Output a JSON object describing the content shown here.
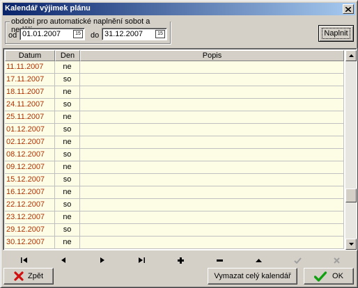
{
  "window": {
    "title": "Kalendář výjimek plánu"
  },
  "period": {
    "legend": "období pro automatické naplnění sobot a nedělí",
    "from_label": "od",
    "from_value": "01.01.2007",
    "to_label": "do",
    "to_value": "31.12.2007",
    "cal_icon_text": "15",
    "fill_button": "Naplnit"
  },
  "grid": {
    "columns": [
      "Datum",
      "Den",
      "Popis"
    ],
    "rows": [
      [
        "11.11.2007",
        "ne",
        ""
      ],
      [
        "17.11.2007",
        "so",
        ""
      ],
      [
        "18.11.2007",
        "ne",
        ""
      ],
      [
        "24.11.2007",
        "so",
        ""
      ],
      [
        "25.11.2007",
        "ne",
        ""
      ],
      [
        "01.12.2007",
        "so",
        ""
      ],
      [
        "02.12.2007",
        "ne",
        ""
      ],
      [
        "08.12.2007",
        "so",
        ""
      ],
      [
        "09.12.2007",
        "ne",
        ""
      ],
      [
        "15.12.2007",
        "so",
        ""
      ],
      [
        "16.12.2007",
        "ne",
        ""
      ],
      [
        "22.12.2007",
        "so",
        ""
      ],
      [
        "23.12.2007",
        "ne",
        ""
      ],
      [
        "29.12.2007",
        "so",
        ""
      ],
      [
        "30.12.2007",
        "ne",
        ""
      ]
    ],
    "scroll_position": 0.78
  },
  "navigator": [
    "first-icon",
    "prior-icon",
    "next-icon",
    "last-icon",
    "insert-icon",
    "delete-icon",
    "edit-icon",
    "post-icon",
    "cancel-icon"
  ],
  "buttons": {
    "back": "Zpět",
    "clear_all": "Vymazat celý kalendář",
    "ok": "OK"
  },
  "colors": {
    "title_start": "#0a246a",
    "title_end": "#a6caf0",
    "date_text": "#b03000",
    "row_bg": "#fdfde6"
  }
}
